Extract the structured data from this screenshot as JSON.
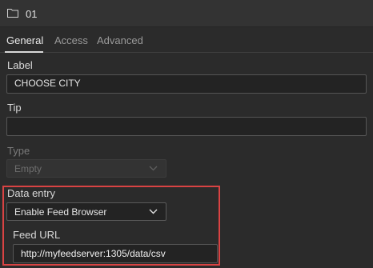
{
  "header": {
    "title": "01",
    "icon": "folder-icon"
  },
  "tabs": [
    {
      "label": "General",
      "active": true
    },
    {
      "label": "Access",
      "active": false
    },
    {
      "label": "Advanced",
      "active": false
    }
  ],
  "fields": {
    "label": {
      "label": "Label",
      "value": "CHOOSE CITY"
    },
    "tip": {
      "label": "Tip",
      "value": ""
    },
    "type": {
      "label": "Type",
      "value": "Empty",
      "disabled": true
    },
    "data_entry": {
      "label": "Data entry",
      "value": "Enable Feed Browser"
    },
    "feed_url": {
      "label": "Feed URL",
      "value": "http://myfeedserver:1305/data/csv"
    }
  },
  "colors": {
    "background": "#2b2b2b",
    "highlight": "#d94343"
  }
}
